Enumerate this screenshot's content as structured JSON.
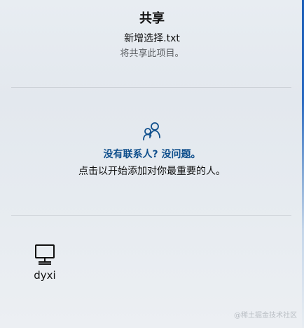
{
  "share_panel": {
    "title": "共享",
    "filename": "新增选择.txt",
    "description": "将共享此项目。"
  },
  "empty_state": {
    "icon": "people-icon",
    "title": "没有联系人? 没问题。",
    "message": "点击以开始添加对你最重要的人。"
  },
  "devices": [
    {
      "icon": "computer-icon",
      "name": "dyxi"
    }
  ],
  "watermark": "@稀土掘金技术社区",
  "colors": {
    "accent": "#0f4f8c",
    "edge": "#1d5fb8"
  }
}
